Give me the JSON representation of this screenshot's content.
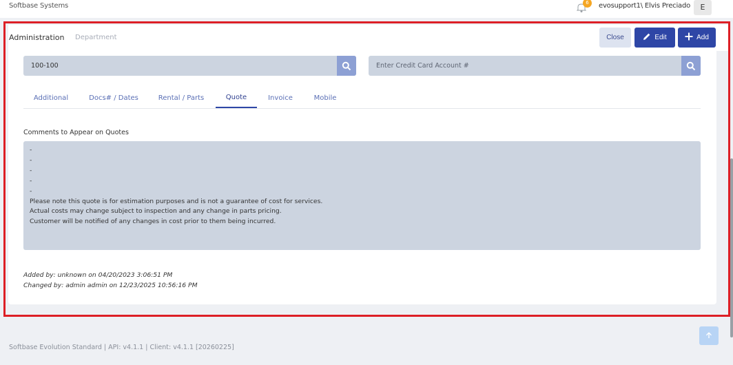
{
  "topbar": {
    "brand": "Softbase Systems",
    "notification_count": "6",
    "username": "evosupport1\\ Elvis Preciado",
    "avatar_initial": "E"
  },
  "header": {
    "title": "Administration",
    "subtitle": "Department",
    "close_label": "Close",
    "edit_label": "Edit",
    "add_label": "Add"
  },
  "search": {
    "account_value": "100-100",
    "credit_card_placeholder": "Enter Credit Card Account #"
  },
  "tabs": [
    {
      "label": "Additional"
    },
    {
      "label": "Docs# / Dates"
    },
    {
      "label": "Rental / Parts"
    },
    {
      "label": "Quote"
    },
    {
      "label": "Invoice"
    },
    {
      "label": "Mobile"
    }
  ],
  "active_tab": "Quote",
  "comments": {
    "label": "Comments to Appear on Quotes",
    "text": "-\n-\n-\n-\n-\nPlease note this quote is for estimation purposes and is not a guarantee of cost for services.\nActual costs may change subject to inspection and any change in parts pricing.\nCustomer will be notified of any changes in cost prior to them being incurred."
  },
  "audit": {
    "added_by": "Added by: unknown on 04/20/2023 3:06:51 PM",
    "changed_by": "Changed by: admin admin on 12/23/2025 10:56:16 PM"
  },
  "footer": {
    "text": "Softbase Evolution Standard | API: v4.1.1 | Client: v4.1.1 [20260225]"
  },
  "colors": {
    "primary": "#2e46a6",
    "input_bg": "#ccd4e0",
    "highlight_frame": "#dd1f26",
    "badge": "#f5a623"
  }
}
